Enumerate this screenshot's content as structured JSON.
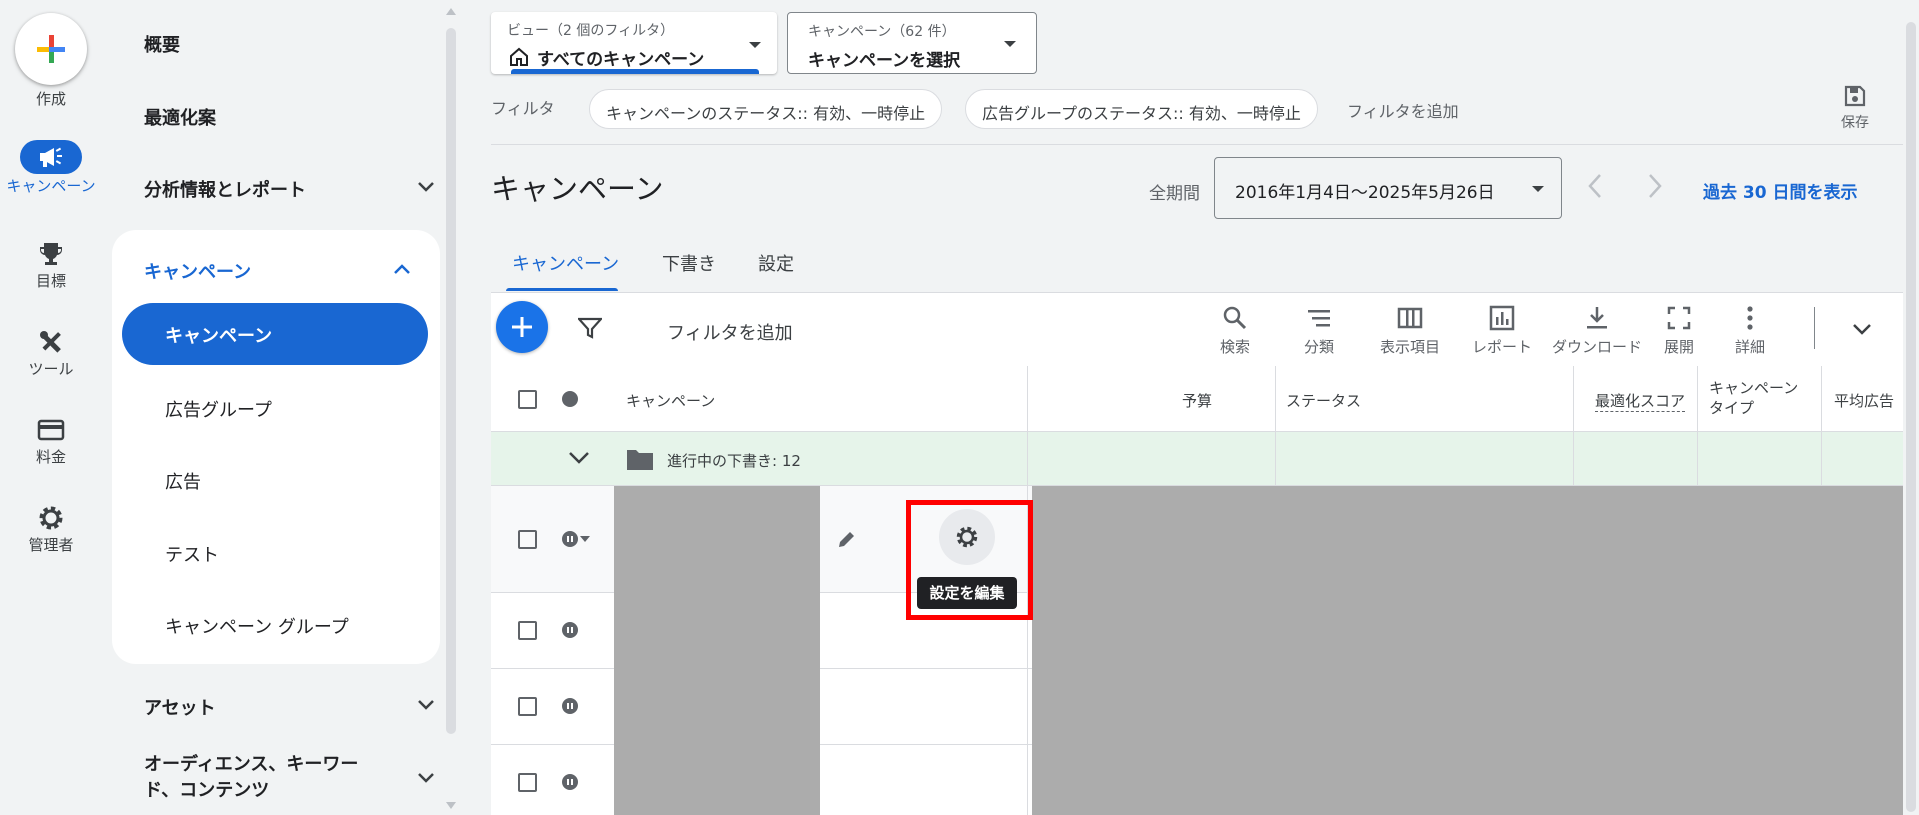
{
  "rail": {
    "create": "作成",
    "campaigns": "キャンペーン",
    "goals": "目標",
    "tools": "ツール",
    "billing": "料金",
    "admin": "管理者"
  },
  "nav": {
    "overview": "概要",
    "recommendations": "最適化案",
    "insights": "分析情報とレポート",
    "campaigns_section": "キャンペーン",
    "campaigns_sub": "キャンペーン",
    "ad_groups": "広告グループ",
    "ads": "広告",
    "experiments": "テスト",
    "campaign_groups": "キャンペーン グループ",
    "assets": "アセット",
    "audiences": "オーディエンス、キーワー",
    "audiences_line2": "ド、コンテンツ"
  },
  "view_selector": {
    "caption": "ビュー（2 個のフィルタ）",
    "value": "すべてのキャンペーン"
  },
  "campaign_selector": {
    "caption": "キャンペーン（62 件）",
    "value": "キャンペーンを選択"
  },
  "filters": {
    "label": "フィルタ",
    "chips": [
      "キャンペーンのステータス:: 有効、一時停止",
      "広告グループのステータス:: 有効、一時停止"
    ],
    "add": "フィルタを追加",
    "save": "保存"
  },
  "page": {
    "title": "キャンペーン",
    "period_label": "全期間",
    "date_range": "2016年1月4日～2025年5月26日",
    "last30": "過去 30 日間を表示"
  },
  "tabs": [
    "キャンペーン",
    "下書き",
    "設定"
  ],
  "toolbar": {
    "add_filter": "フィルタを追加",
    "tools": [
      "検索",
      "分類",
      "表示項目",
      "レポート",
      "ダウンロード",
      "展開",
      "詳細"
    ]
  },
  "table": {
    "columns": {
      "campaign": "キャンペーン",
      "budget": "予算",
      "status": "ステータス",
      "opt_score": "最適化スコア",
      "type_line1": "キャンペーン",
      "type_line2": "タイプ",
      "avg": "平均広告"
    },
    "drafts_row": "進行中の下書き: 12"
  },
  "tooltip": "設定を編集",
  "colors": {
    "accent": "#1967d2",
    "highlight": "#ff0000",
    "draft_row_bg": "#e6f4ea",
    "redacted": "#acacac"
  }
}
